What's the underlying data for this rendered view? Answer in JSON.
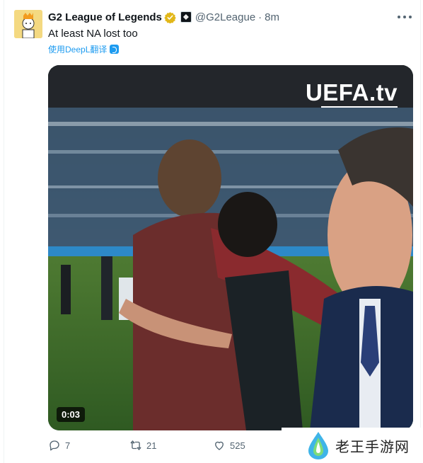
{
  "tweet": {
    "author_name": "G2 League of Legends",
    "handle": "@G2League",
    "separator": "·",
    "time": "8m",
    "text": "At least NA lost too",
    "translate_label": "使用DeepL翻译",
    "video": {
      "overlay_logo": "UEFA.tv",
      "timecode": "0:03"
    },
    "actions": {
      "replies": "7",
      "retweets": "21",
      "likes": "525"
    },
    "icons": {
      "verified": "verified-badge-icon",
      "affiliate": "affiliate-badge-icon",
      "more": "more-options-icon",
      "reply": "reply-icon",
      "retweet": "retweet-icon",
      "like": "like-icon"
    }
  },
  "watermark": {
    "text": "老王手游网"
  },
  "colors": {
    "text_primary": "#0f1419",
    "text_secondary": "#536471",
    "link": "#1d9bf0",
    "verified_gold": "#e2b719"
  }
}
